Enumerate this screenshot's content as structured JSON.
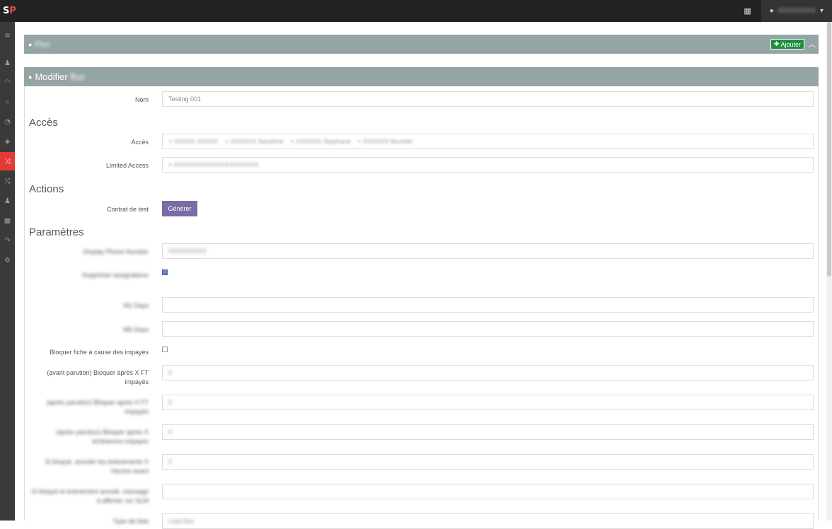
{
  "topbar": {
    "logo_main": "S",
    "logo_accent": "P",
    "user_name": "XXXXXXXX"
  },
  "panel_flux": {
    "title_blurred": "Flux",
    "add_label": "Ajouter"
  },
  "panel_edit": {
    "title": "Modifier",
    "title_blurred": "flux"
  },
  "form": {
    "nom_label": "Nom",
    "nom_value": "Testing 001",
    "section_acces": "Accès",
    "acces_label": "Accès",
    "acces_tags": [
      "× XXXXX XXXXX",
      "× XXXXXX Sandrine",
      "× XXXXXX Stephane",
      "× XXXXXX Murielle"
    ],
    "limited_label": "Limited Access",
    "limited_tag": "× XXXXXXXXXXXXXXXXXXXX",
    "section_actions": "Actions",
    "contrat_label": "Contrat de test",
    "generer_label": "Générer",
    "section_parametres": "Paramètres",
    "phone_label": "Display Phone Number",
    "phone_value": "XXXXXXXXX",
    "supprimer_label": "Supprimer assignations",
    "m1_label": "M1 Days",
    "m6_label": "M6 Days",
    "bloquer_label": "Bloquer fiche à cause des impayés",
    "avant_label": "(avant parution) Bloquer après X FT impayés",
    "avant_value": "0",
    "apres_label": "(après parution) Bloquer après X FT impayés",
    "apres_value": "0",
    "apres2_label": "(après parution) Bloquer après X échéances impayés",
    "apres2_value": "0",
    "si_bloque_label": "Si bloqué, annuler les événements X Heures avant",
    "si_bloque_value": "0",
    "si_bloque_msg_label": "Si bloqué et événement annulé, message à afficher sur SLM",
    "last_label": "Type de liste",
    "last_value": "Liste fixe"
  },
  "colors": {
    "topbar": "#222222",
    "sidebar": "#3a3a3a",
    "active": "#e53935",
    "panel_head": "#95a5a6",
    "add_button": "#1e8e3e",
    "generer_button": "#7a6ba3"
  }
}
